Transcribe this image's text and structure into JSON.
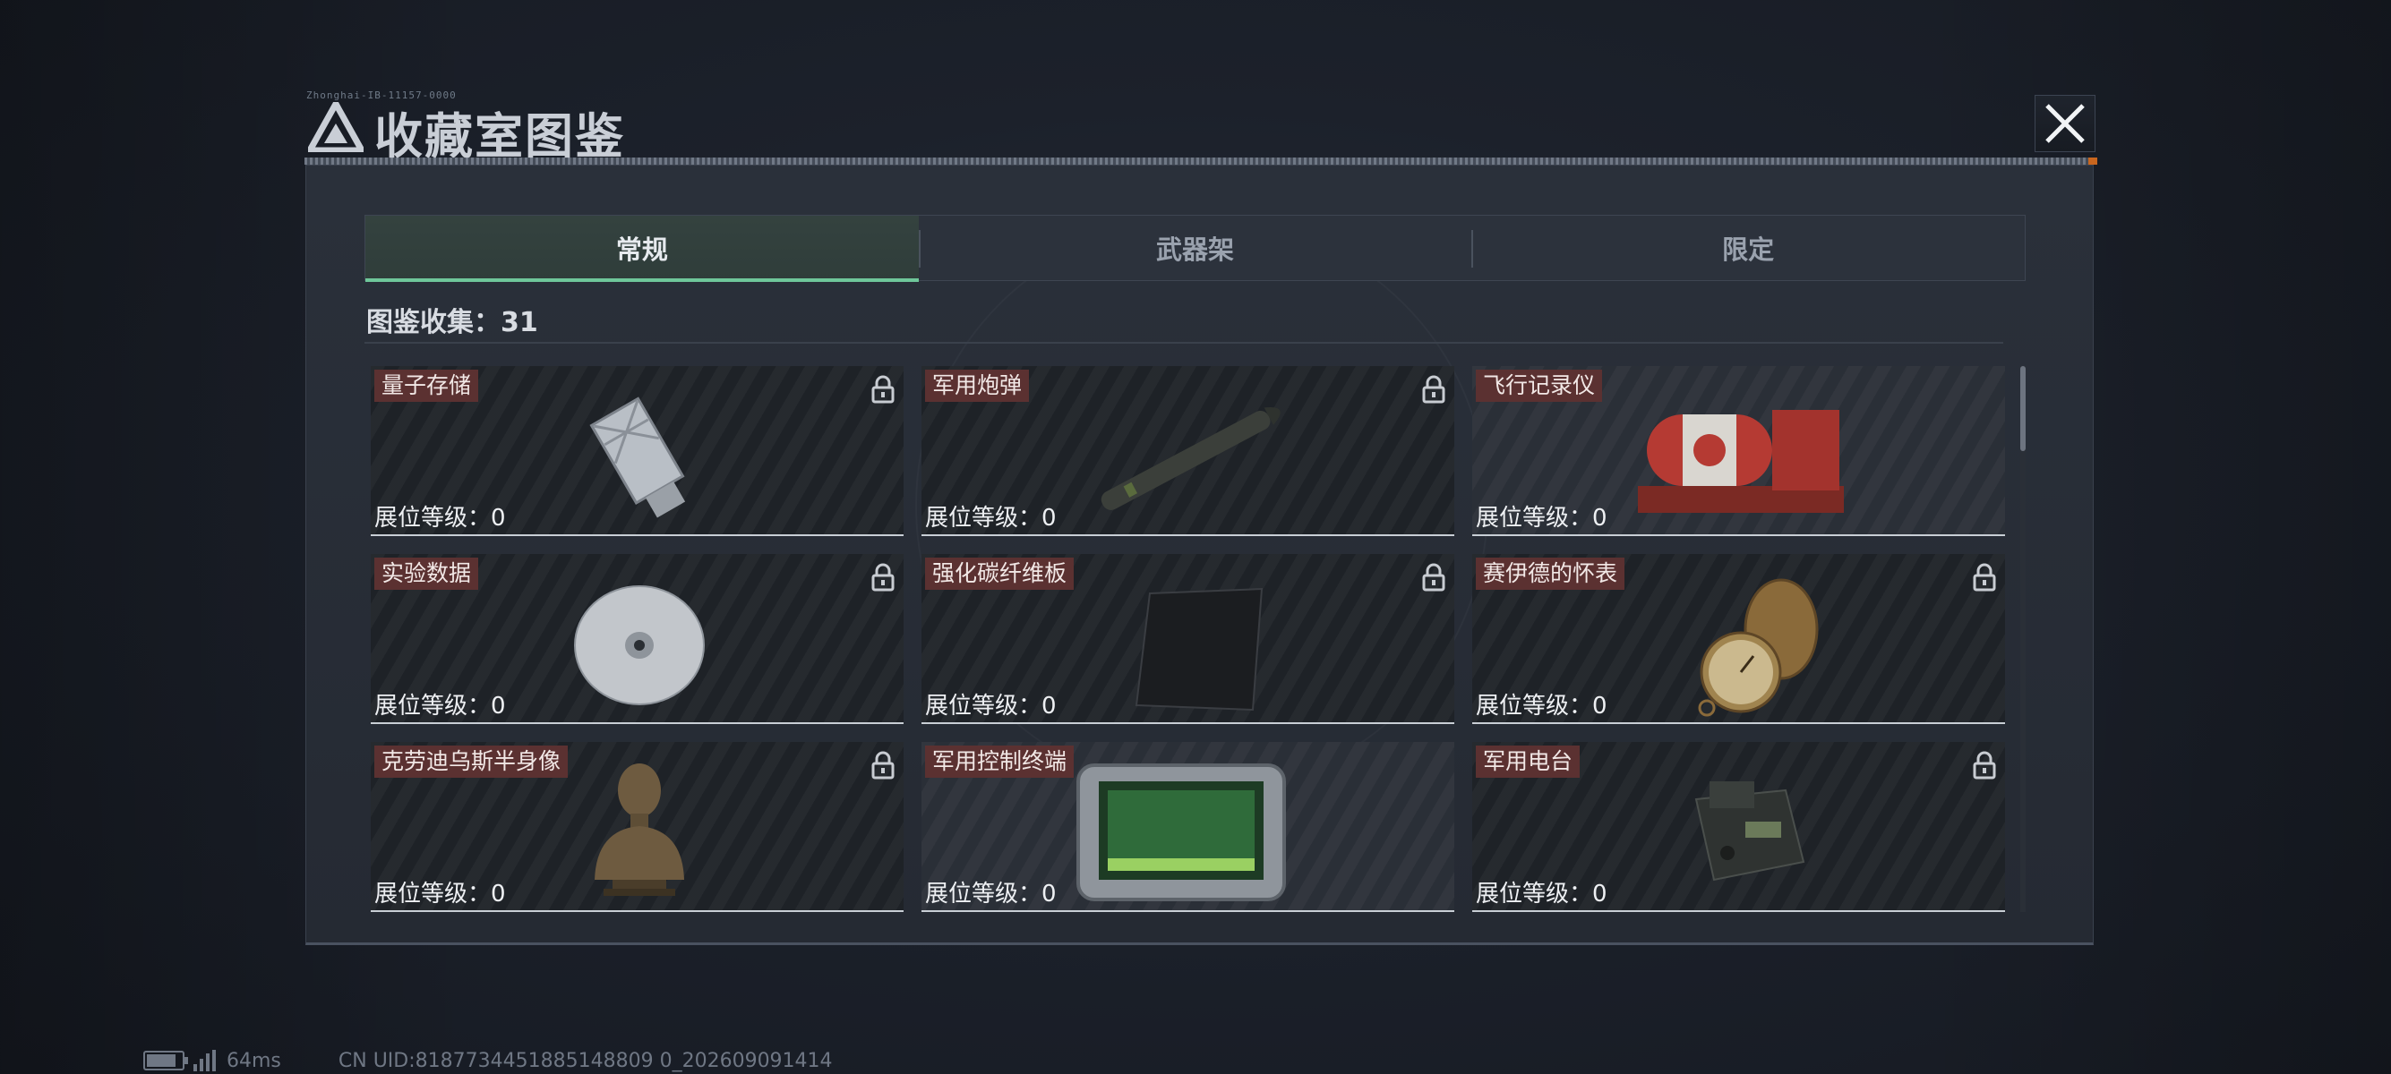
{
  "header": {
    "tiny_text": "Zhonghai-IB-11157-0000",
    "title": "收藏室图鉴"
  },
  "tabs": [
    {
      "label": "常规",
      "active": true
    },
    {
      "label": "武器架",
      "active": false
    },
    {
      "label": "限定",
      "active": false
    }
  ],
  "collection": {
    "label": "图鉴收集：31"
  },
  "level_label": "展位等级：0",
  "items": [
    {
      "name": "量子存储",
      "icon": "usb-drive-icon",
      "locked": true
    },
    {
      "name": "军用炮弹",
      "icon": "artillery-shell-icon",
      "locked": true
    },
    {
      "name": "飞行记录仪",
      "icon": "flight-recorder-icon",
      "locked": false
    },
    {
      "name": "实验数据",
      "icon": "disc-icon",
      "locked": true
    },
    {
      "name": "强化碳纤维板",
      "icon": "carbon-plate-icon",
      "locked": true
    },
    {
      "name": "赛伊德的怀表",
      "icon": "pocket-watch-icon",
      "locked": true
    },
    {
      "name": "克劳迪乌斯半身像",
      "icon": "bust-icon",
      "locked": true
    },
    {
      "name": "军用控制终端",
      "icon": "control-terminal-icon",
      "locked": false
    },
    {
      "name": "军用电台",
      "icon": "radio-icon",
      "locked": true
    }
  ],
  "status_bar": {
    "ping": "64ms",
    "uid": "CN UID:8187734451885148809 0_202609091414"
  },
  "colors": {
    "accent_tab_underline": "#6fc79a",
    "name_tag_bg": "#5b3131",
    "header_rule_end": "#c9661e"
  }
}
